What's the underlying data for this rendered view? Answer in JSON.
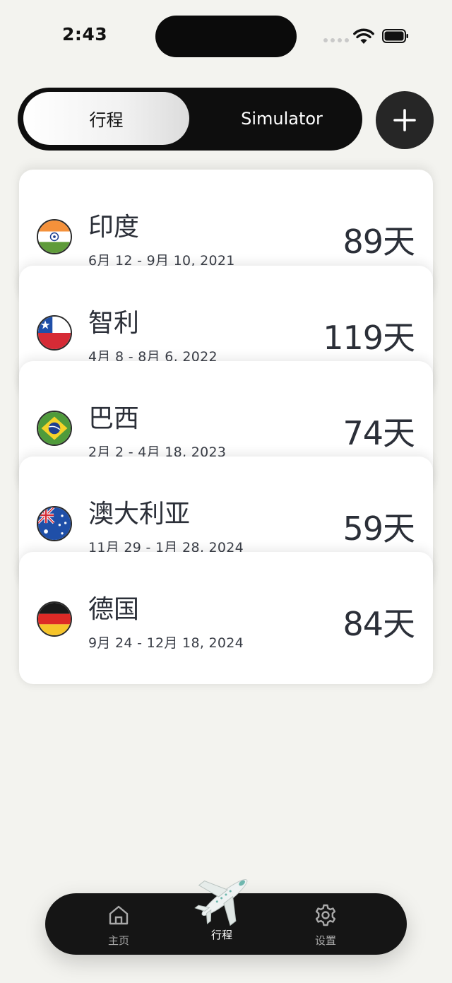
{
  "status_bar": {
    "time": "2:43"
  },
  "segmented": {
    "active_label": "行程",
    "inactive_label": "Simulator"
  },
  "add_button": {
    "icon": "plus-icon"
  },
  "trips": [
    {
      "country": "印度",
      "dates": "6月 12 - 9月 10, 2021",
      "days": "89天",
      "flag": "india"
    },
    {
      "country": "智利",
      "dates": "4月 8 - 8月 6, 2022",
      "days": "119天",
      "flag": "chile"
    },
    {
      "country": "巴西",
      "dates": "2月 2 - 4月 18, 2023",
      "days": "74天",
      "flag": "brazil"
    },
    {
      "country": "澳大利亚",
      "dates": "11月 29 - 1月 28, 2024",
      "days": "59天",
      "flag": "australia"
    },
    {
      "country": "德国",
      "dates": "9月 24 - 12月 18, 2024",
      "days": "84天",
      "flag": "germany"
    }
  ],
  "tabbar": {
    "home_label": "主页",
    "trips_label": "行程",
    "settings_label": "设置",
    "active": "trips"
  },
  "colors": {
    "background": "#f3f3ef",
    "dark": "#0e0e0e",
    "card": "#ffffff"
  }
}
